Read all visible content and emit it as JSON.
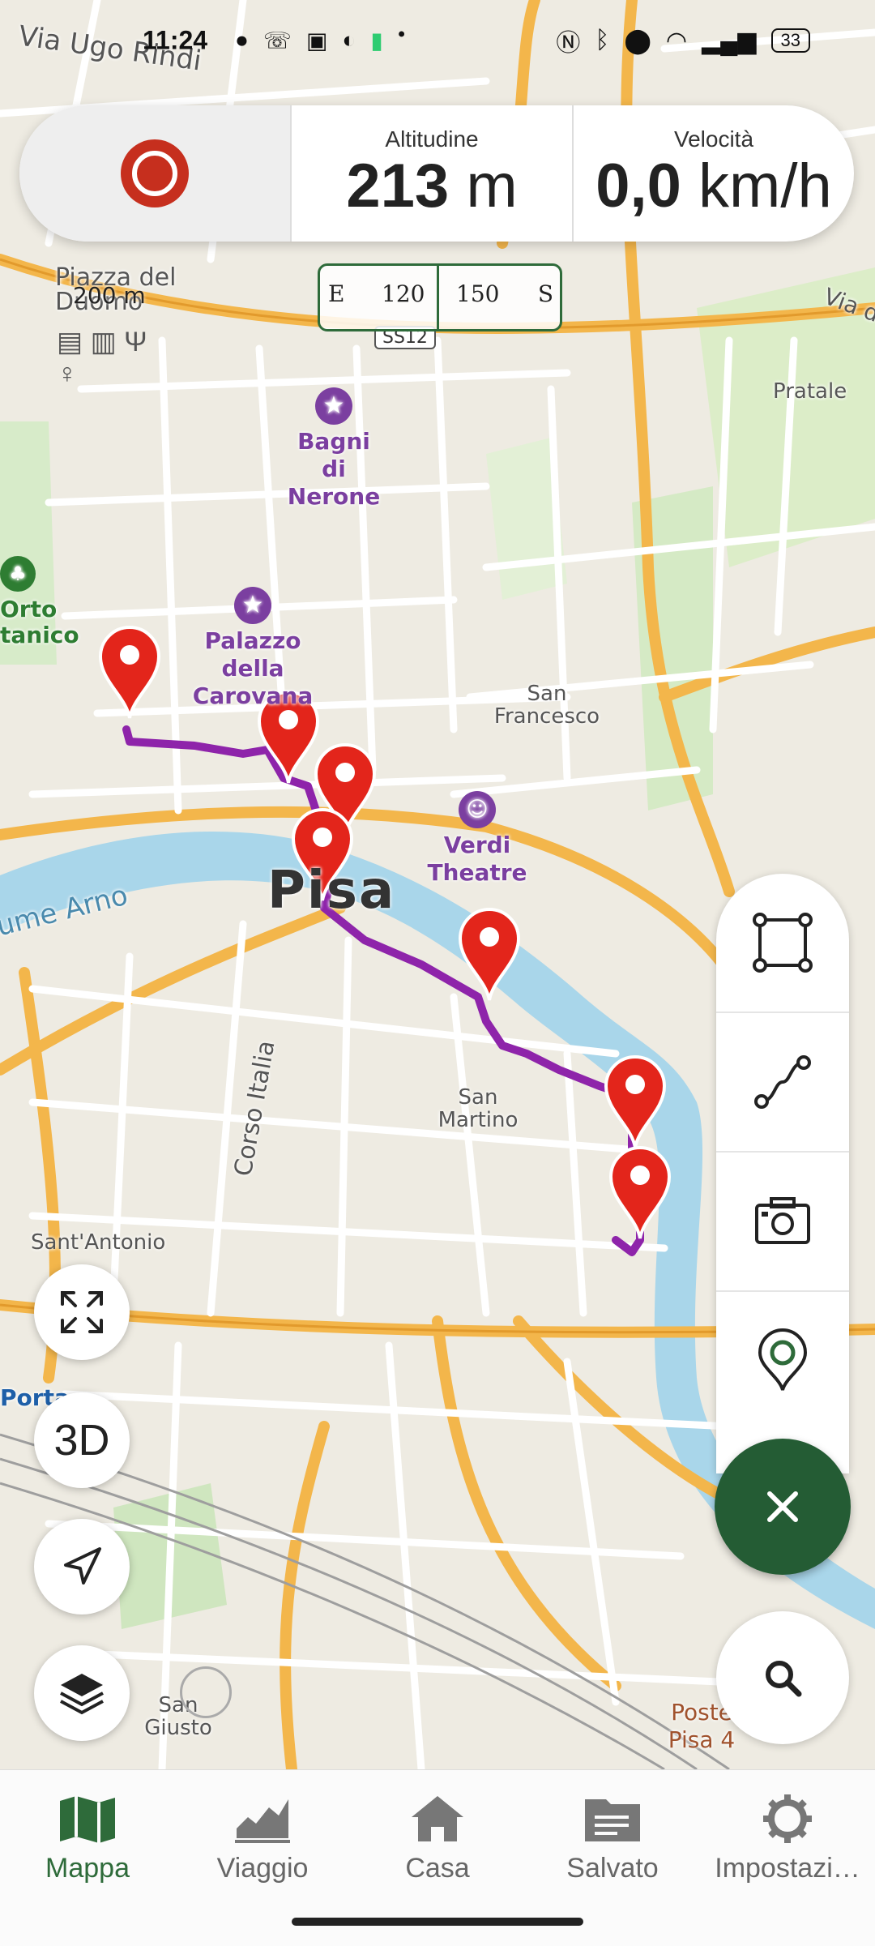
{
  "status_bar": {
    "time": "11:24",
    "battery": "33"
  },
  "info_card": {
    "altitude_label": "Altitudine",
    "altitude_value": "213",
    "altitude_unit": "m",
    "speed_label": "Velocità",
    "speed_value": "0,0",
    "speed_unit": "km/h"
  },
  "compass": {
    "left": "E",
    "tick1": "120",
    "tick2": "150",
    "right": "S"
  },
  "scale_label": "200 m",
  "map_labels": {
    "via_ugo_rindi": "Via Ugo Rindi",
    "piazza": "Piazza del Duomo",
    "via_d": "Via d",
    "pratale": "Pratale",
    "ss12": "SS12",
    "bagni": "Bagni di Nerone",
    "orto": "Orto tanico",
    "palazzo": "Palazzo della Carovana",
    "san_francesco": "San Francesco",
    "verdi": "Verdi Theatre",
    "city": "Pisa",
    "arno": "ume Arno",
    "corso_italia": "Corso Italia",
    "san_martino": "San Martino",
    "sant_antonio": "Sant'Antonio",
    "porta": "Porta",
    "san_giusto": "San Giusto",
    "poste": "Poste Pisa 4"
  },
  "left_buttons": {
    "three_d": "3D"
  },
  "nav": [
    {
      "label": "Mappa"
    },
    {
      "label": "Viaggio"
    },
    {
      "label": "Casa"
    },
    {
      "label": "Salvato"
    },
    {
      "label": "Impostazi…"
    }
  ],
  "colors": {
    "accent": "#2e6b3a",
    "record": "#c62f1e",
    "route": "#8e24aa",
    "marker": "#e3251b",
    "water": "#a9d6ea"
  }
}
